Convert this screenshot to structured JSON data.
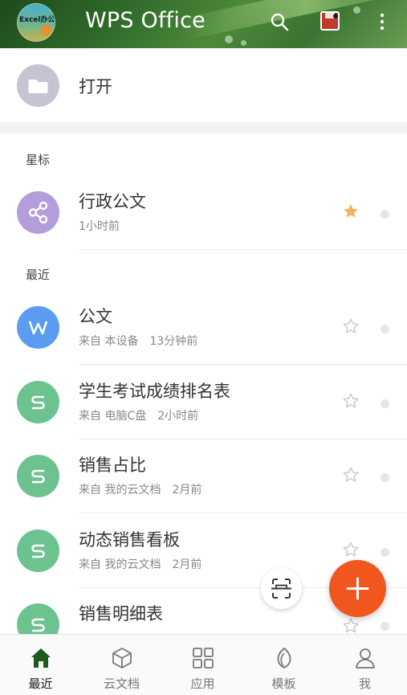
{
  "header": {
    "app_title": "WPS Office",
    "avatar_text": "Excel办公",
    "icons": [
      "search-icon",
      "document-icon",
      "more-vertical-icon"
    ]
  },
  "open": {
    "label": "打开",
    "icon": "folder-icon"
  },
  "sections": {
    "starred": "星标",
    "recent": "最近"
  },
  "starred_items": [
    {
      "title": "行政公文",
      "meta": [
        "1小时前"
      ],
      "icon": "share-icon",
      "color": "#b39ddb",
      "starred": true
    }
  ],
  "recent_items": [
    {
      "title": "公文",
      "meta": [
        "来自 本设备",
        "13分钟前"
      ],
      "icon": "wps-writer-icon",
      "color": "#5b9cf0",
      "starred": false
    },
    {
      "title": "学生考试成绩排名表",
      "meta": [
        "来自 电脑C盘",
        "2小时前"
      ],
      "icon": "spreadsheet-icon",
      "color": "#6cc38f",
      "starred": false
    },
    {
      "title": "销售占比",
      "meta": [
        "来自 我的云文档",
        "2月前"
      ],
      "icon": "spreadsheet-icon",
      "color": "#6cc38f",
      "starred": false
    },
    {
      "title": "动态销售看板",
      "meta": [
        "来自 我的云文档",
        "2月前"
      ],
      "icon": "spreadsheet-icon",
      "color": "#6cc38f",
      "starred": false
    },
    {
      "title": "销售明细表",
      "meta": [],
      "icon": "spreadsheet-icon",
      "color": "#6cc38f",
      "starred": false
    }
  ],
  "fab": {
    "scan_icon": "scan-icon",
    "add_icon": "plus-icon",
    "add_color": "#f1561f"
  },
  "bottom_nav": [
    {
      "label": "最近",
      "icon": "home-icon",
      "active": true
    },
    {
      "label": "云文档",
      "icon": "cube-icon",
      "active": false
    },
    {
      "label": "应用",
      "icon": "grid-icon",
      "active": false
    },
    {
      "label": "模板",
      "icon": "leaf-icon",
      "active": false
    },
    {
      "label": "我",
      "icon": "user-icon",
      "active": false
    }
  ],
  "colors": {
    "star_active": "#f2b45a",
    "star_inactive": "#c9c9c9",
    "nav_active": "#1f5a1c"
  }
}
